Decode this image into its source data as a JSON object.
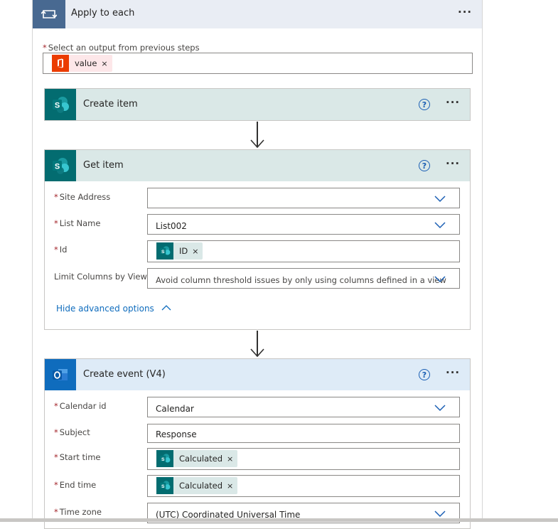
{
  "loop": {
    "title": "Apply to each",
    "menu": "···",
    "select_label": "Select an output from previous steps",
    "required_mark": "*",
    "token": {
      "label": "value",
      "remove": "×",
      "icon": "office-icon"
    }
  },
  "create_item": {
    "title": "Create item",
    "help": "?",
    "menu": "···",
    "icon": "sharepoint-icon"
  },
  "get_item": {
    "title": "Get item",
    "help": "?",
    "menu": "···",
    "icon": "sharepoint-icon",
    "fields": {
      "site_address": {
        "label": "Site Address",
        "value": ""
      },
      "list_name": {
        "label": "List Name",
        "value": "List002"
      },
      "id": {
        "label": "Id",
        "token": "ID",
        "remove": "×"
      },
      "limit_columns": {
        "label": "Limit Columns by View",
        "value": "Avoid column threshold issues by only using columns defined in a view"
      }
    },
    "hide_advanced": "Hide advanced options"
  },
  "create_event": {
    "title": "Create event (V4)",
    "help": "?",
    "menu": "···",
    "icon": "outlook-icon",
    "fields": {
      "calendar_id": {
        "label": "Calendar id",
        "value": "Calendar"
      },
      "subject": {
        "label": "Subject",
        "value": "Response"
      },
      "start_time": {
        "label": "Start time",
        "token": "Calculated",
        "remove": "×"
      },
      "end_time": {
        "label": "End time",
        "token": "Calculated",
        "remove": "×"
      },
      "time_zone": {
        "label": "Time zone",
        "value": "(UTC) Coordinated Universal Time"
      }
    }
  },
  "colors": {
    "loop_accent": "#486991",
    "sharepoint": "#036c70",
    "outlook": "#0f6cbd",
    "office": "#eb3c00",
    "link": "#0f6cbd"
  }
}
